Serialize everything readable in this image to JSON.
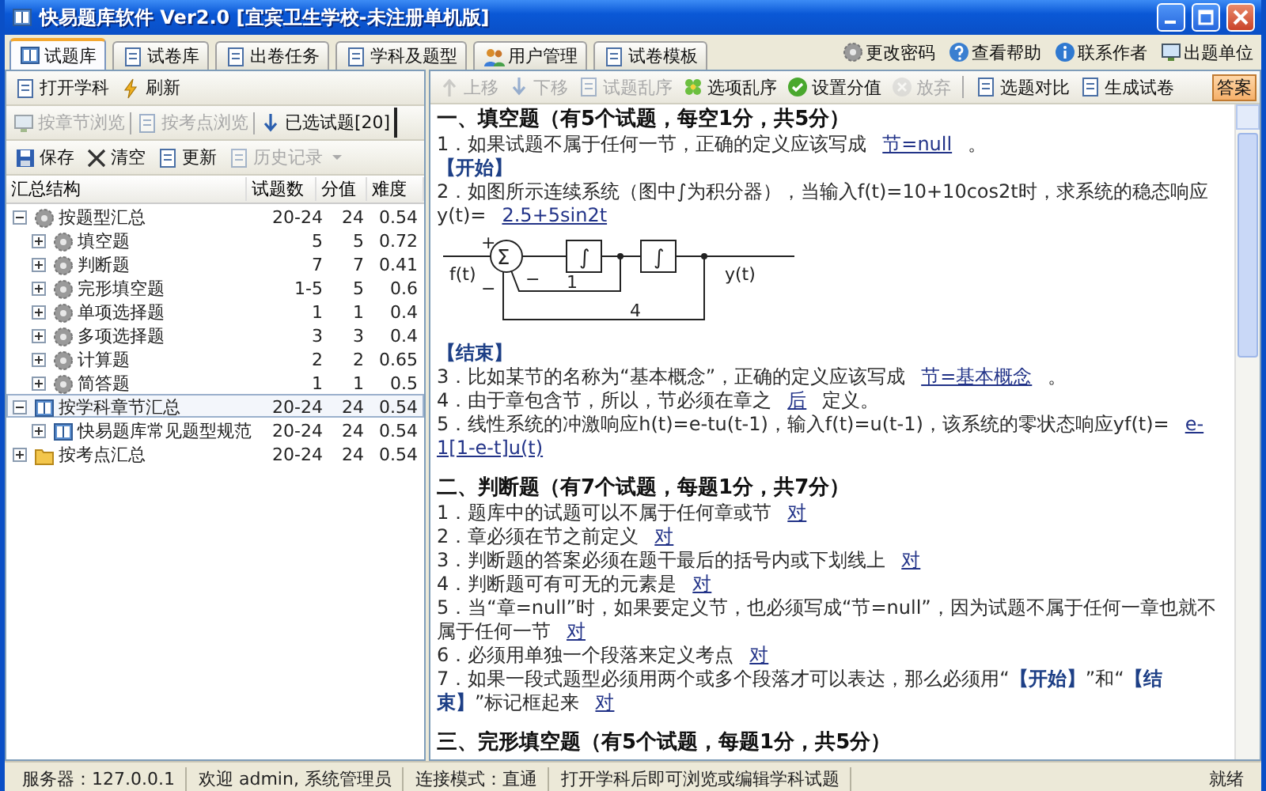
{
  "window": {
    "title": "快易题库软件 Ver2.0 [宜宾卫生学校-未注册单机版]"
  },
  "tabs": [
    {
      "label": "试题库",
      "selected": true
    },
    {
      "label": "试卷库",
      "selected": false
    },
    {
      "label": "出卷任务",
      "selected": false
    },
    {
      "label": "学科及题型",
      "selected": false
    },
    {
      "label": "用户管理",
      "selected": false
    },
    {
      "label": "试卷模板",
      "selected": false
    }
  ],
  "header_links": [
    "更改密码",
    "查看帮助",
    "联系作者",
    "出题单位"
  ],
  "left_panel": {
    "toolbar": [
      {
        "label": "打开学科",
        "disabled": false
      },
      {
        "label": "刷新",
        "disabled": false
      }
    ],
    "view_tabs": [
      {
        "label": "按章节浏览",
        "selected": false,
        "disabled": true
      },
      {
        "label": "按考点浏览",
        "selected": false,
        "disabled": true
      },
      {
        "label": "已选试题[20]",
        "selected": true,
        "disabled": false
      }
    ],
    "actions": [
      {
        "label": "保存",
        "disabled": false
      },
      {
        "label": "清空",
        "disabled": false
      },
      {
        "label": "更新",
        "disabled": false
      },
      {
        "label": "历史记录",
        "disabled": true
      }
    ],
    "tree": {
      "columns": [
        "汇总结构",
        "试题数",
        "分值",
        "难度"
      ],
      "rows": [
        {
          "name": "按题型汇总",
          "count": "20-24",
          "score": "24",
          "difficulty": "0.54",
          "expanded": true,
          "selected": false,
          "children": [
            {
              "name": "填空题",
              "count": "5",
              "score": "5",
              "difficulty": "0.72",
              "expanded": false,
              "selected": false
            },
            {
              "name": "判断题",
              "count": "7",
              "score": "7",
              "difficulty": "0.41",
              "expanded": false,
              "selected": false
            },
            {
              "name": "完形填空题",
              "count": "1-5",
              "score": "5",
              "difficulty": "0.6",
              "expanded": false,
              "selected": false
            },
            {
              "name": "单项选择题",
              "count": "1",
              "score": "1",
              "difficulty": "0.4",
              "expanded": false,
              "selected": false
            },
            {
              "name": "多项选择题",
              "count": "3",
              "score": "3",
              "difficulty": "0.4",
              "expanded": false,
              "selected": false
            },
            {
              "name": "计算题",
              "count": "2",
              "score": "2",
              "difficulty": "0.65",
              "expanded": false,
              "selected": false
            },
            {
              "name": "简答题",
              "count": "1",
              "score": "1",
              "difficulty": "0.5",
              "expanded": false,
              "selected": false
            }
          ]
        },
        {
          "name": "按学科章节汇总",
          "count": "20-24",
          "score": "24",
          "difficulty": "0.54",
          "expanded": true,
          "selected": true,
          "children": [
            {
              "name": "快易题库常见题型规范",
              "count": "20-24",
              "score": "24",
              "difficulty": "0.54",
              "expanded": false,
              "selected": false
            }
          ]
        },
        {
          "name": "按考点汇总",
          "count": "20-24",
          "score": "24",
          "difficulty": "0.54",
          "expanded": false,
          "selected": false
        }
      ]
    }
  },
  "content_toolbar": [
    {
      "label": "上移",
      "disabled": true
    },
    {
      "label": "下移",
      "disabled": true
    },
    {
      "label": "试题乱序",
      "disabled": true
    },
    {
      "label": "选项乱序",
      "disabled": false
    },
    {
      "label": "设置分值",
      "disabled": false
    },
    {
      "label": "放弃",
      "disabled": true
    },
    {
      "label": "选题对比",
      "disabled": false
    },
    {
      "label": "生成试卷",
      "disabled": false
    }
  ],
  "answer_button": {
    "label": "答案",
    "on": true
  },
  "document": [
    {
      "heading": "一、填空题（有5个试题，每空1分，共5分）",
      "items": [
        {
          "kind": "question",
          "text": "1．如果试题不属于任何一节，正确的定义应该写成",
          "answer": "节=null",
          "suffix": "。"
        },
        {
          "kind": "marker",
          "text": "【开始】"
        },
        {
          "kind": "question",
          "text": "2．如图所示连续系统（图中∫为积分器），当输入f(t)=10+10cos2t时，求系统的稳态响应y(t)=",
          "answer": "2.5+5sin2t"
        },
        {
          "kind": "diagram",
          "input": "f(t)",
          "output": "y(t)",
          "sum": "Σ",
          "blocks": [
            "∫",
            "∫"
          ],
          "signs": [
            "+",
            "−",
            "−"
          ],
          "gains": [
            "1",
            "4"
          ]
        },
        {
          "kind": "marker",
          "text": "【结束】"
        },
        {
          "kind": "question",
          "text": "3．比如某节的名称为“基本概念”，正确的定义应该写成",
          "answer": "节=基本概念",
          "suffix": "。"
        },
        {
          "kind": "question",
          "text": "4．由于章包含节，所以，节必须在章之",
          "answer": "后",
          "suffix": "定义。"
        },
        {
          "kind": "question",
          "text": "5．线性系统的冲激响应h(t)=e-tu(t-1)，输入f(t)=u(t-1)，该系统的零状态响应yf(t)=",
          "answer": "e-1[1-e-t]u(t)"
        }
      ]
    },
    {
      "heading": "二、判断题（有7个试题，每题1分，共7分）",
      "items": [
        {
          "kind": "question",
          "text": "1．题库中的试题可以不属于任何章或节",
          "answer": "对"
        },
        {
          "kind": "question",
          "text": "2．章必须在节之前定义",
          "answer": "对"
        },
        {
          "kind": "question",
          "text": "3．判断题的答案必须在题干最后的括号内或下划线上",
          "answer": "对"
        },
        {
          "kind": "question",
          "text": "4．判断题可有可无的元素是",
          "answer": "对"
        },
        {
          "kind": "question",
          "text": "5．当“章=null”时，如果要定义节，也必须写成“节=null”，因为试题不属于任何一章也就不属于任何一节",
          "answer": "对"
        },
        {
          "kind": "question",
          "text": "6．必须用单独一个段落来定义考点",
          "answer": "对"
        },
        {
          "kind": "question",
          "text": "7．如果一段式题型必须用两个或多个段落才可以表达，那么必须用“**【开始】**”和“**【结束】**”标记框起来",
          "answer": "对"
        }
      ]
    },
    {
      "heading": "三、完形填空题（有5个试题，每题1分，共5分）"
    }
  ],
  "status_bar": [
    "服务器：127.0.0.1",
    "欢迎 admin, 系统管理员",
    "连接模式：直通",
    "打开学科后即可浏览或编辑学科试题",
    "就绪"
  ]
}
